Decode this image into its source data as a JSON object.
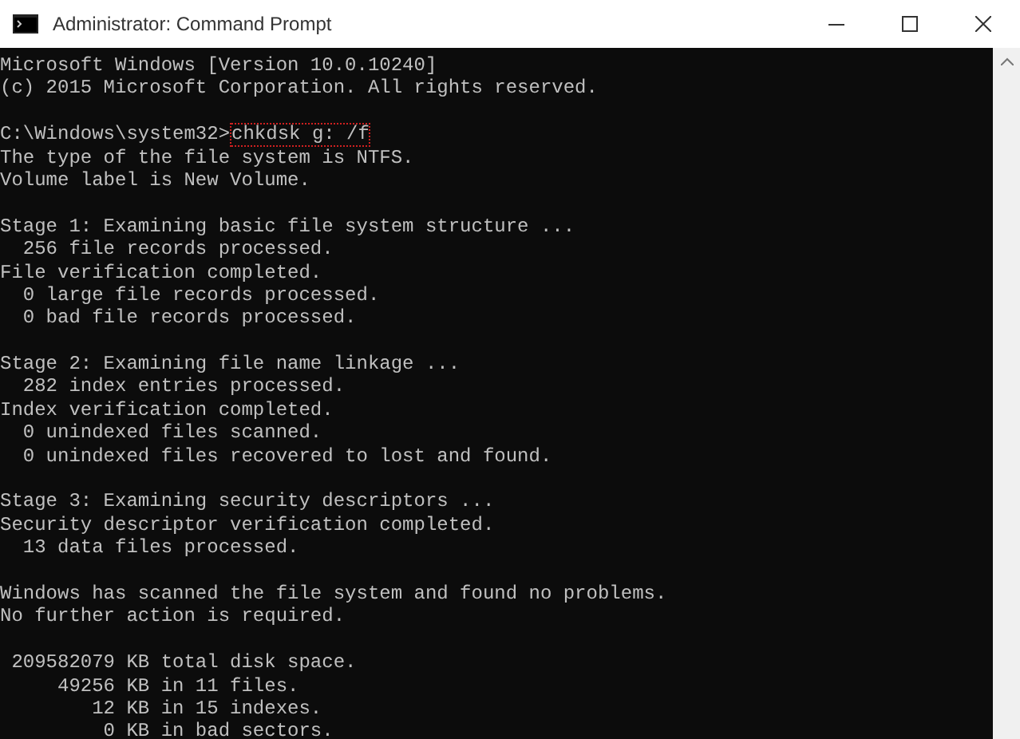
{
  "window": {
    "title": "Administrator: Command Prompt"
  },
  "console": {
    "lines": [
      {
        "kind": "text",
        "text": "Microsoft Windows [Version 10.0.10240]"
      },
      {
        "kind": "text",
        "text": "(c) 2015 Microsoft Corporation. All rights reserved."
      },
      {
        "kind": "blank"
      },
      {
        "kind": "prompt",
        "prompt": "C:\\Windows\\system32>",
        "command": "chkdsk g: /f",
        "highlighted": true
      },
      {
        "kind": "text",
        "text": "The type of the file system is NTFS."
      },
      {
        "kind": "text",
        "text": "Volume label is New Volume."
      },
      {
        "kind": "blank"
      },
      {
        "kind": "text",
        "text": "Stage 1: Examining basic file system structure ..."
      },
      {
        "kind": "text",
        "text": "  256 file records processed."
      },
      {
        "kind": "text",
        "text": "File verification completed."
      },
      {
        "kind": "text",
        "text": "  0 large file records processed."
      },
      {
        "kind": "text",
        "text": "  0 bad file records processed."
      },
      {
        "kind": "blank"
      },
      {
        "kind": "text",
        "text": "Stage 2: Examining file name linkage ..."
      },
      {
        "kind": "text",
        "text": "  282 index entries processed."
      },
      {
        "kind": "text",
        "text": "Index verification completed."
      },
      {
        "kind": "text",
        "text": "  0 unindexed files scanned."
      },
      {
        "kind": "text",
        "text": "  0 unindexed files recovered to lost and found."
      },
      {
        "kind": "blank"
      },
      {
        "kind": "text",
        "text": "Stage 3: Examining security descriptors ..."
      },
      {
        "kind": "text",
        "text": "Security descriptor verification completed."
      },
      {
        "kind": "text",
        "text": "  13 data files processed."
      },
      {
        "kind": "blank"
      },
      {
        "kind": "text",
        "text": "Windows has scanned the file system and found no problems."
      },
      {
        "kind": "text",
        "text": "No further action is required."
      },
      {
        "kind": "blank"
      },
      {
        "kind": "text",
        "text": " 209582079 KB total disk space."
      },
      {
        "kind": "text",
        "text": "     49256 KB in 11 files."
      },
      {
        "kind": "text",
        "text": "        12 KB in 15 indexes."
      },
      {
        "kind": "text",
        "text": "         0 KB in bad sectors."
      }
    ]
  }
}
